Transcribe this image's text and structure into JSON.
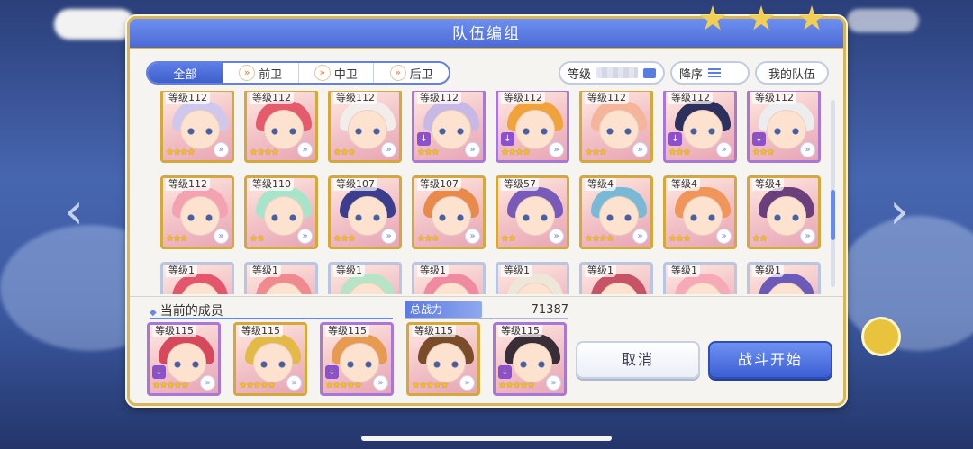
{
  "dialog": {
    "title": "队伍编组"
  },
  "tabs": [
    {
      "label": "全部",
      "active": true
    },
    {
      "label": "前卫",
      "active": false
    },
    {
      "label": "中卫",
      "active": false
    },
    {
      "label": "后卫",
      "active": false
    }
  ],
  "controls": {
    "level_label": "等级",
    "sort_label": "降序",
    "myteam_label": "我的队伍"
  },
  "roster": [
    {
      "level": "等级112",
      "stars": "★★★★",
      "hair": "#cfc8ec",
      "frame": "gold"
    },
    {
      "level": "等级112",
      "stars": "★★★★",
      "hair": "#e45b6c",
      "frame": "gold"
    },
    {
      "level": "等级112",
      "stars": "★★★",
      "hair": "#f2ecea",
      "frame": "gold"
    },
    {
      "level": "等级112",
      "stars": "★★★",
      "hair": "#c7b8e6",
      "frame": "purple"
    },
    {
      "level": "等级112",
      "stars": "★★★★",
      "hair": "#f0a23b",
      "frame": "purple"
    },
    {
      "level": "等级112",
      "stars": "★★★",
      "hair": "#f5b59a",
      "frame": "gold"
    },
    {
      "level": "等级112",
      "stars": "★★★",
      "hair": "#2d2f5c",
      "frame": "purple"
    },
    {
      "level": "等级112",
      "stars": "★★★",
      "hair": "#ededf0",
      "frame": "purple"
    },
    {
      "level": "等级112",
      "stars": "★★★",
      "hair": "#f3a2b2",
      "frame": "gold"
    },
    {
      "level": "等级110",
      "stars": "★★",
      "hair": "#a8e4c9",
      "frame": "gold"
    },
    {
      "level": "等级107",
      "stars": "★★★",
      "hair": "#3c3d8c",
      "frame": "gold"
    },
    {
      "level": "等级107",
      "stars": "★★★",
      "hair": "#e78a4b",
      "frame": "gold"
    },
    {
      "level": "等级57",
      "stars": "★★",
      "hair": "#7a5ab8",
      "frame": "gold"
    },
    {
      "level": "等级4",
      "stars": "★★★★",
      "hair": "#79b9d6",
      "frame": "gold"
    },
    {
      "level": "等级4",
      "stars": "★★★",
      "hair": "#f0965a",
      "frame": "gold"
    },
    {
      "level": "等级4",
      "stars": "★★",
      "hair": "#6a3f7c",
      "frame": "gold"
    },
    {
      "level": "等级1",
      "stars": "",
      "hair": "#e3566b",
      "frame": "silver"
    },
    {
      "level": "等级1",
      "stars": "",
      "hair": "#ef8a8e",
      "frame": "silver"
    },
    {
      "level": "等级1",
      "stars": "",
      "hair": "#b7e4c6",
      "frame": "silver"
    },
    {
      "level": "等级1",
      "stars": "",
      "hair": "#f08aa0",
      "frame": "silver"
    },
    {
      "level": "等级1",
      "stars": "",
      "hair": "#efe6da",
      "frame": "silver"
    },
    {
      "level": "等级1",
      "stars": "",
      "hair": "#c65466",
      "frame": "silver"
    },
    {
      "level": "等级1",
      "stars": "",
      "hair": "#f6a9b7",
      "frame": "silver"
    },
    {
      "level": "等级1",
      "stars": "",
      "hair": "#6d5ab8",
      "frame": "silver"
    }
  ],
  "members": {
    "label": "当前的成员",
    "power_label": "总战力",
    "power_value": "71387",
    "list": [
      {
        "level": "等级115",
        "stars": "★★★★★",
        "hair": "#d6485c",
        "frame": "purple"
      },
      {
        "level": "等级115",
        "stars": "★★★★★",
        "hair": "#e3b948",
        "frame": "gold"
      },
      {
        "level": "等级115",
        "stars": "★★★★★",
        "hair": "#e79a52",
        "frame": "purple"
      },
      {
        "level": "等级115",
        "stars": "★★★★★",
        "hair": "#7a4c2a",
        "frame": "gold"
      },
      {
        "level": "等级115",
        "stars": "★★★★★",
        "hair": "#3a2e36",
        "frame": "purple"
      }
    ]
  },
  "buttons": {
    "cancel": "取消",
    "start": "战斗开始"
  }
}
